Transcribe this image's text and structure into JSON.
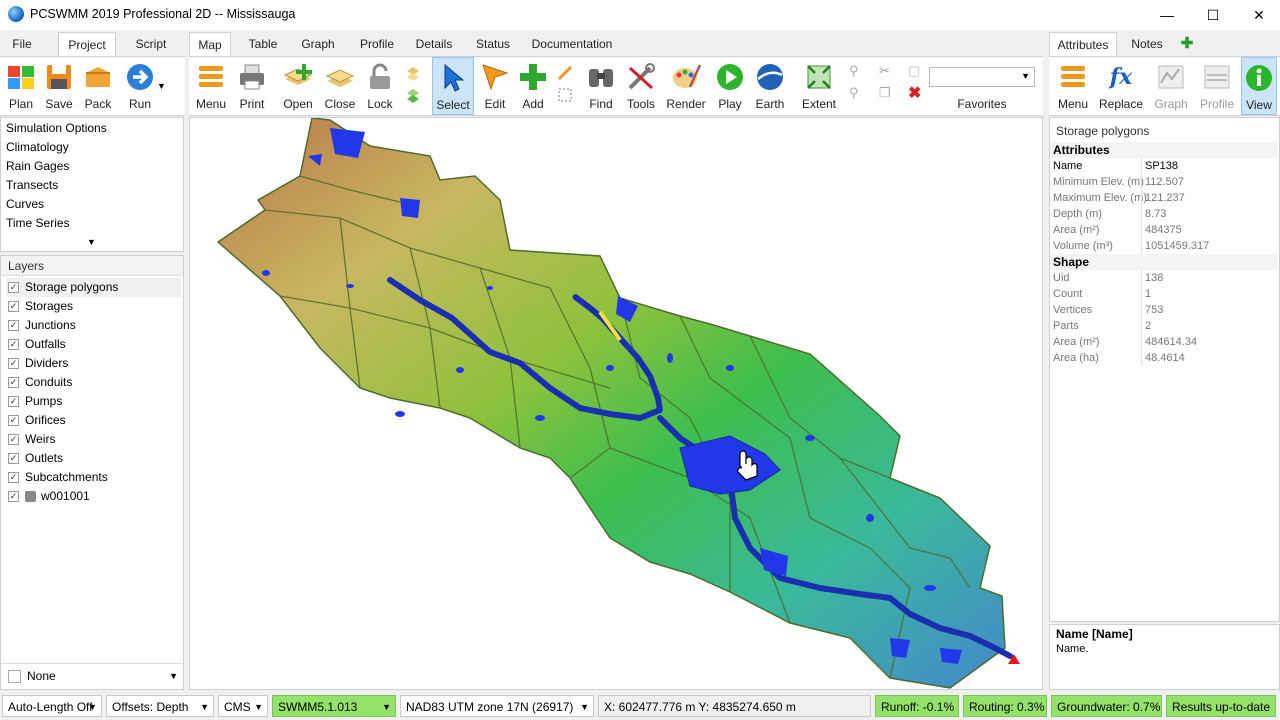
{
  "window": {
    "title": "PCSWMM 2019 Professional 2D -- Mississauga",
    "minimize": "—",
    "maximize": "☐",
    "close": "✕"
  },
  "left_tabs": [
    "File",
    "Project",
    "Script"
  ],
  "center_tabs": [
    "Map",
    "Table",
    "Graph",
    "Profile",
    "Details",
    "Status",
    "Documentation"
  ],
  "right_tabs": [
    "Attributes",
    "Notes"
  ],
  "project_tools": [
    "Plan",
    "Save",
    "Pack",
    "Run"
  ],
  "map_tools": [
    "Menu",
    "Print",
    "Open",
    "Close",
    "Lock",
    "Select",
    "Edit",
    "Add",
    "Find",
    "Tools",
    "Render",
    "Play",
    "Earth",
    "Extent"
  ],
  "favorites_label": "Favorites",
  "attr_tools": [
    "Menu",
    "Replace",
    "Graph",
    "Profile",
    "View"
  ],
  "project_items": [
    "Simulation Options",
    "Climatology",
    "Rain Gages",
    "Transects",
    "Curves",
    "Time Series"
  ],
  "layers_title": "Layers",
  "layers": [
    {
      "name": "Storage polygons",
      "checked": true
    },
    {
      "name": "Storages",
      "checked": true
    },
    {
      "name": "Junctions",
      "checked": true
    },
    {
      "name": "Outfalls",
      "checked": true
    },
    {
      "name": "Dividers",
      "checked": true
    },
    {
      "name": "Conduits",
      "checked": true
    },
    {
      "name": "Pumps",
      "checked": true
    },
    {
      "name": "Orifices",
      "checked": true
    },
    {
      "name": "Weirs",
      "checked": true
    },
    {
      "name": "Outlets",
      "checked": true
    },
    {
      "name": "Subcatchments",
      "checked": true
    },
    {
      "name": "w001001",
      "checked": true
    }
  ],
  "layer_filter": "None",
  "attributes": {
    "panel_title": "Storage polygons",
    "section_attributes": "Attributes",
    "rows_attributes": [
      {
        "k": "Name",
        "v": "SP138"
      },
      {
        "k": "Minimum Elev. (m)",
        "v": "112.507"
      },
      {
        "k": "Maximum Elev. (m)",
        "v": "121.237"
      },
      {
        "k": "Depth (m)",
        "v": "8.73"
      },
      {
        "k": "Area (m²)",
        "v": "484375"
      },
      {
        "k": "Volume (m³)",
        "v": "1051459.317"
      }
    ],
    "section_shape": "Shape",
    "rows_shape": [
      {
        "k": "Uid",
        "v": "138"
      },
      {
        "k": "Count",
        "v": "1"
      },
      {
        "k": "Vertices",
        "v": "753"
      },
      {
        "k": "Parts",
        "v": "2"
      },
      {
        "k": "Area (m²)",
        "v": "484614.34"
      },
      {
        "k": "Area (ha)",
        "v": "48.4614"
      }
    ],
    "help_title": "Name [Name]",
    "help_text": "Name."
  },
  "status": {
    "auto_length": "Auto-Length Off",
    "offsets": "Offsets: Depth",
    "units": "CMS",
    "engine": "SWMM5.1.013",
    "projection": "NAD83 UTM zone 17N (26917)",
    "coords": "X: 602477.776 m  Y: 4835274.650 m",
    "runoff": "Runoff: -0.1%",
    "routing": "Routing: 0.3%",
    "groundwater": "Groundwater: 0.7%",
    "results": "Results up-to-date"
  },
  "colors": {
    "accent_green": "#95e26a",
    "select_blue": "#cce4f7",
    "water_blue": "#1f3fe0"
  }
}
